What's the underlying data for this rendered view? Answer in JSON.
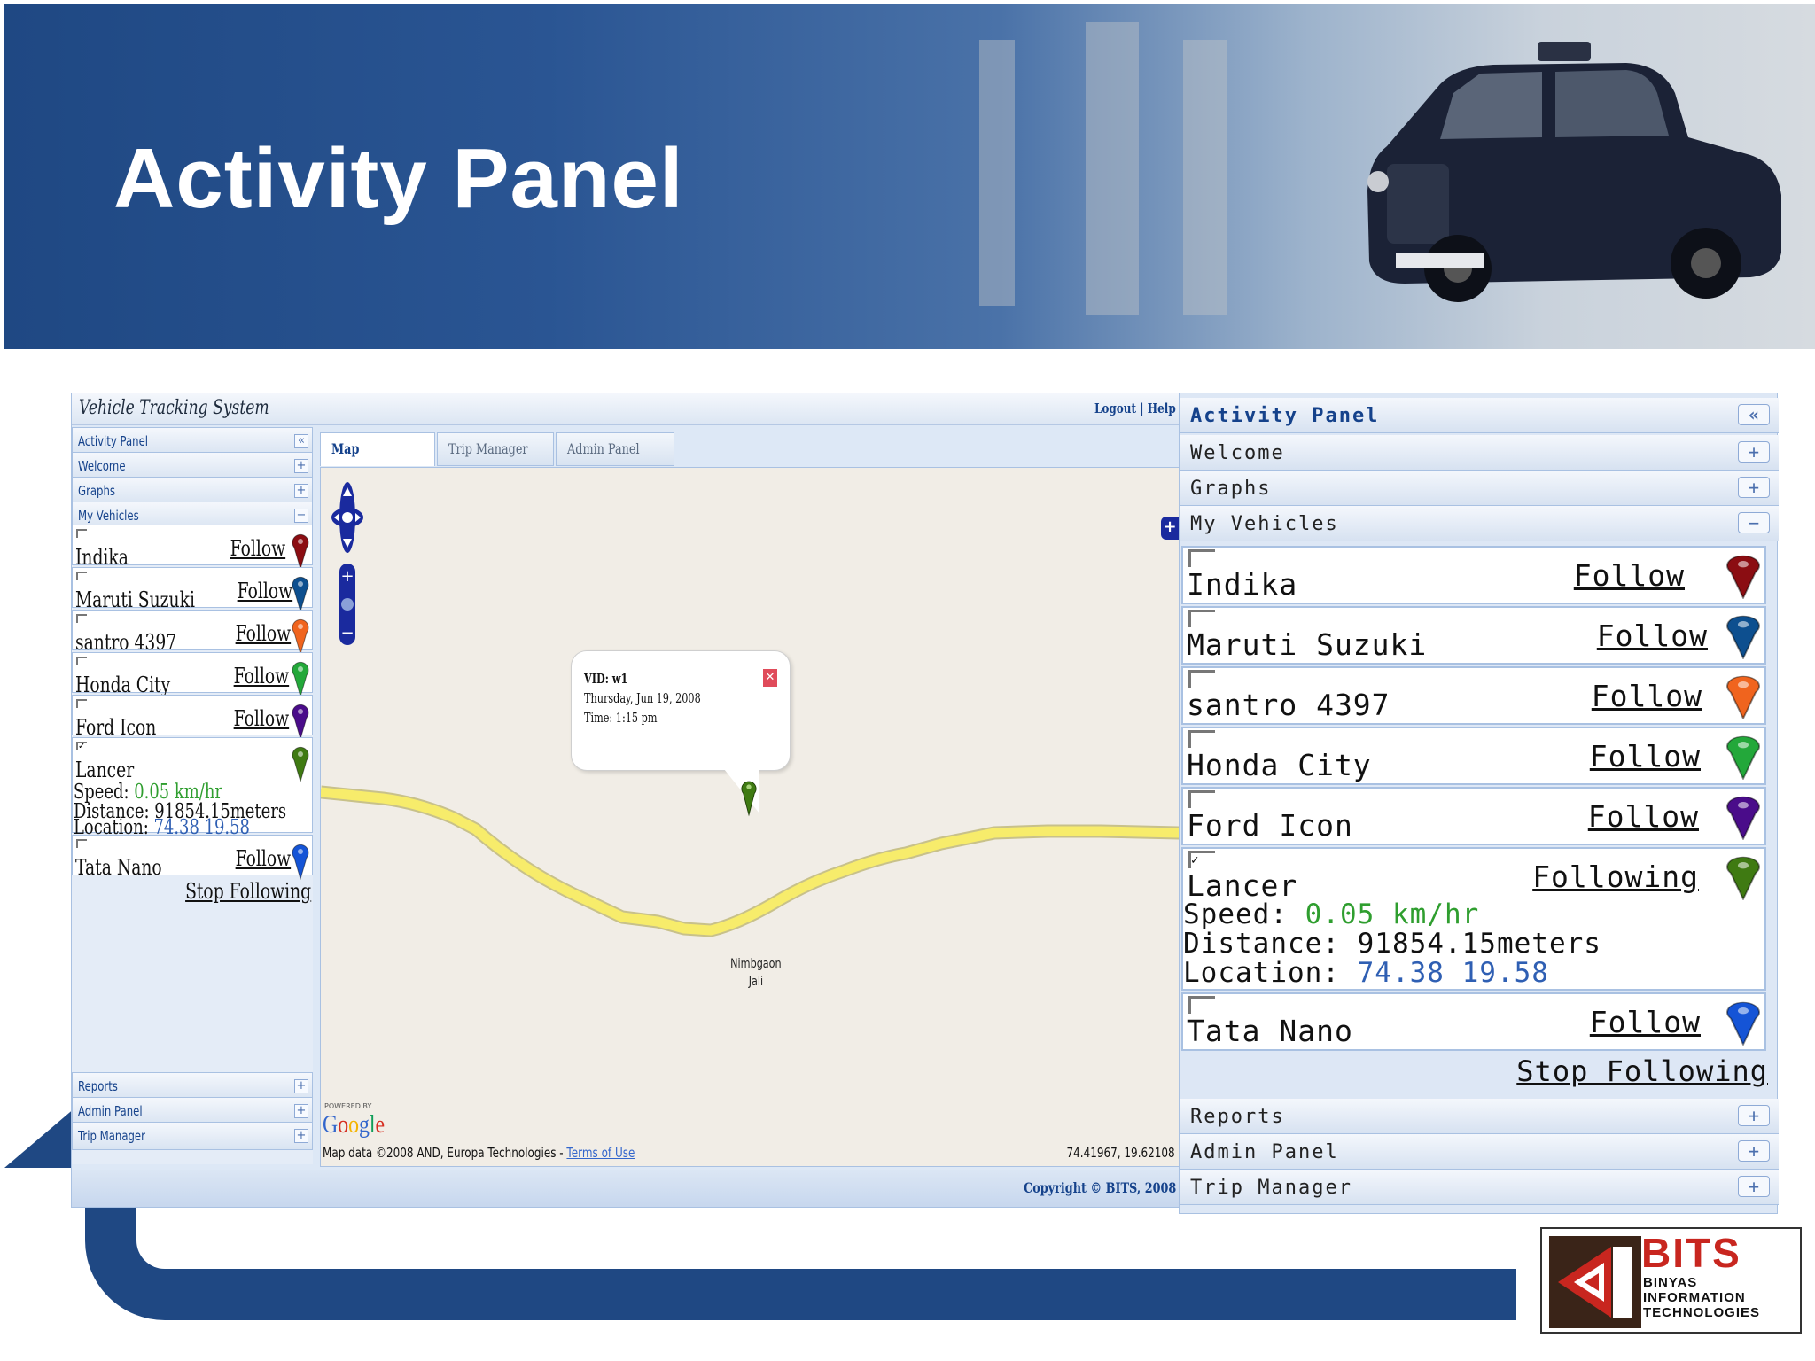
{
  "slide_title": "Activity Panel",
  "app": {
    "title": "Vehicle Tracking System",
    "logout": "Logout",
    "separator": "|",
    "help": "Help",
    "copyright": "Copyright © BITS, 2008"
  },
  "panel": {
    "title": "Activity Panel",
    "collapse": "«",
    "sections_top": [
      {
        "label": "Welcome",
        "toggle": "+"
      },
      {
        "label": "Graphs",
        "toggle": "+"
      },
      {
        "label": "My Vehicles",
        "toggle": "−"
      }
    ],
    "vehicles": [
      {
        "name": "Indika",
        "action": "Follow",
        "action_zoom": "Follow",
        "checked": false,
        "color": "#8b0d12"
      },
      {
        "name": "Maruti Suzuki",
        "action": "Follow",
        "action_zoom": "Follow",
        "checked": false,
        "color": "#0d4f8f"
      },
      {
        "name": "santro 4397",
        "action": "Follow",
        "action_zoom": "Follow",
        "checked": false,
        "color": "#f0641e"
      },
      {
        "name": "Honda City",
        "action": "Follow",
        "action_zoom": "Follow",
        "checked": false,
        "color": "#23a83a"
      },
      {
        "name": "Ford Icon",
        "action": "Follow",
        "action_zoom": "Follow",
        "checked": false,
        "color": "#4a0c8a"
      },
      {
        "name": "Lancer",
        "action": "",
        "action_zoom": "Following",
        "checked": true,
        "color": "#3f7a12",
        "speed_label": "Speed: ",
        "speed_small": "0.05 km/hr",
        "speed_zoom": "0.05 km/hr",
        "distance_label": "Distance: ",
        "distance_small": "91854.15meters",
        "distance_zoom": "91854.15meters",
        "location_label": "Location: ",
        "location_small": "74.38 19.58",
        "location_zoom": "74.38 19.58"
      },
      {
        "name": "Tata Nano",
        "action": "Follow",
        "action_zoom": "Follow",
        "checked": false,
        "color": "#1554d6"
      }
    ],
    "stop_following": "Stop Following",
    "sections_bottom": [
      {
        "label": "Reports",
        "toggle": "+"
      },
      {
        "label": "Admin Panel",
        "toggle": "+"
      },
      {
        "label": "Trip Manager",
        "toggle": "+"
      }
    ],
    "checkmark": "✓"
  },
  "tabs": [
    {
      "label": "Map"
    },
    {
      "label": "Trip Manager"
    },
    {
      "label": "Admin Panel"
    }
  ],
  "map": {
    "popup": {
      "vid": "VID: w1",
      "date": "Thursday, Jun 19, 2008",
      "time": "Time: 1:15 pm",
      "close": "✕"
    },
    "place_line1": "Nimbgaon",
    "place_line2": "Jali",
    "powered_by": "POWERED BY",
    "google": "Google",
    "map_data": "Map data ©2008 AND, Europa Technologies - ",
    "terms": "Terms of Use",
    "coords": "74.41967, 19.62108",
    "expand": "+"
  },
  "logo": {
    "name": "BITS",
    "line1": "BINYAS",
    "line2": "INFORMATION",
    "line3": "TECHNOLOGIES"
  },
  "colors": {
    "banner_blue": "#1f4883",
    "panel_header_text": "#15428b",
    "road_yellow": "#f7ec6b",
    "speed_green": "#2f9e2f",
    "location_blue": "#2f5fb3"
  }
}
